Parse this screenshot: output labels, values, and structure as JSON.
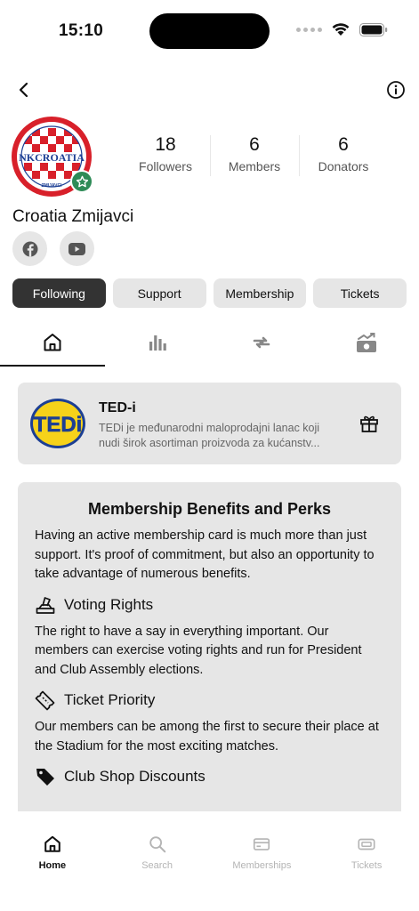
{
  "status_bar": {
    "time": "15:10"
  },
  "nav": {
    "back_icon": "chevron-left-icon",
    "info_icon": "info-icon"
  },
  "profile": {
    "club_name": "Croatia Zmijavci",
    "avatar_logo_text": "NKCROATIA",
    "avatar_logo_subtext": "ZMIJAVCI",
    "stats": [
      {
        "value": "18",
        "label": "Followers"
      },
      {
        "value": "6",
        "label": "Members"
      },
      {
        "value": "6",
        "label": "Donators"
      }
    ],
    "socials": [
      {
        "name": "facebook-icon"
      },
      {
        "name": "youtube-icon"
      }
    ]
  },
  "actions": [
    {
      "label": "Following",
      "active": true
    },
    {
      "label": "Support",
      "active": false
    },
    {
      "label": "Membership",
      "active": false
    },
    {
      "label": "Tickets",
      "active": false
    }
  ],
  "icon_tabs": [
    {
      "name": "home-icon",
      "active": true
    },
    {
      "name": "stats-icon",
      "active": false
    },
    {
      "name": "transfer-icon",
      "active": false
    },
    {
      "name": "donation-icon",
      "active": false
    }
  ],
  "sponsor": {
    "logo_text": "TEDi",
    "title": "TED-i",
    "description": "TEDi je međunarodni maloprodajni lanac koji nudi širok asortiman proizvoda za kućanstv..."
  },
  "benefits": {
    "title": "Membership Benefits and Perks",
    "intro": "Having an active membership card is much more than just support. It's proof of commitment, but also an opportunity to take advantage of numerous benefits.",
    "perks": [
      {
        "icon": "ballot-box-icon",
        "title": "Voting Rights",
        "text": "The right to have a say in everything important. Our members can exercise voting rights and run for President and Club Assembly elections."
      },
      {
        "icon": "ticket-icon",
        "title": "Ticket Priority",
        "text": "Our members can be among the first to secure their place at the Stadium for the most exciting matches."
      },
      {
        "icon": "price-tag-icon",
        "title": "Club Shop Discounts",
        "text": ""
      }
    ]
  },
  "tab_bar": [
    {
      "label": "Home",
      "icon": "home-icon",
      "active": true
    },
    {
      "label": "Search",
      "icon": "search-icon",
      "active": false
    },
    {
      "label": "Memberships",
      "icon": "card-icon",
      "active": false
    },
    {
      "label": "Tickets",
      "icon": "ticket-icon",
      "active": false
    }
  ],
  "colors": {
    "accent_dark": "#333333",
    "chip_bg": "#e6e6e6",
    "badge_green": "#2e8b57",
    "club_red": "#d8202a",
    "sponsor_yellow": "#f6d21a",
    "sponsor_blue": "#1c3f94"
  }
}
